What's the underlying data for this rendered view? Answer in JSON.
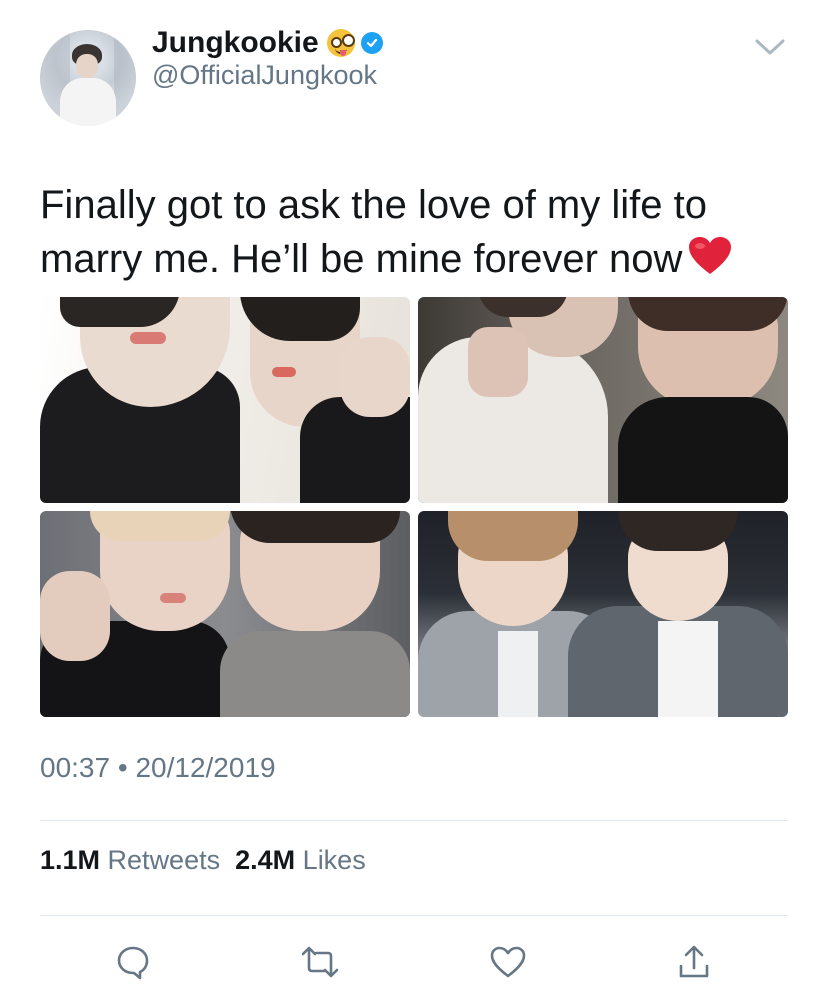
{
  "author": {
    "display_name": "Jungkookie",
    "handle": "@OfficialJungkook",
    "verified": true,
    "name_emoji": "zany-face-emoji",
    "verified_color": "#1da1f2"
  },
  "tweet": {
    "text": "Finally got to ask the love of my life to marry me. He’ll be mine forever now",
    "text_emoji": "red-heart-emoji",
    "time": "00:37",
    "separator": "•",
    "date": "20/12/2019"
  },
  "stats": {
    "retweets_count": "1.1M",
    "retweets_label": "Retweets",
    "likes_count": "2.4M",
    "likes_label": "Likes"
  },
  "actions": [
    "reply-icon",
    "retweet-icon",
    "like-icon",
    "share-icon"
  ],
  "colors": {
    "text_primary": "#14171a",
    "text_secondary": "#657786",
    "divider": "#e1e8ed",
    "heart": "#e0223a"
  }
}
